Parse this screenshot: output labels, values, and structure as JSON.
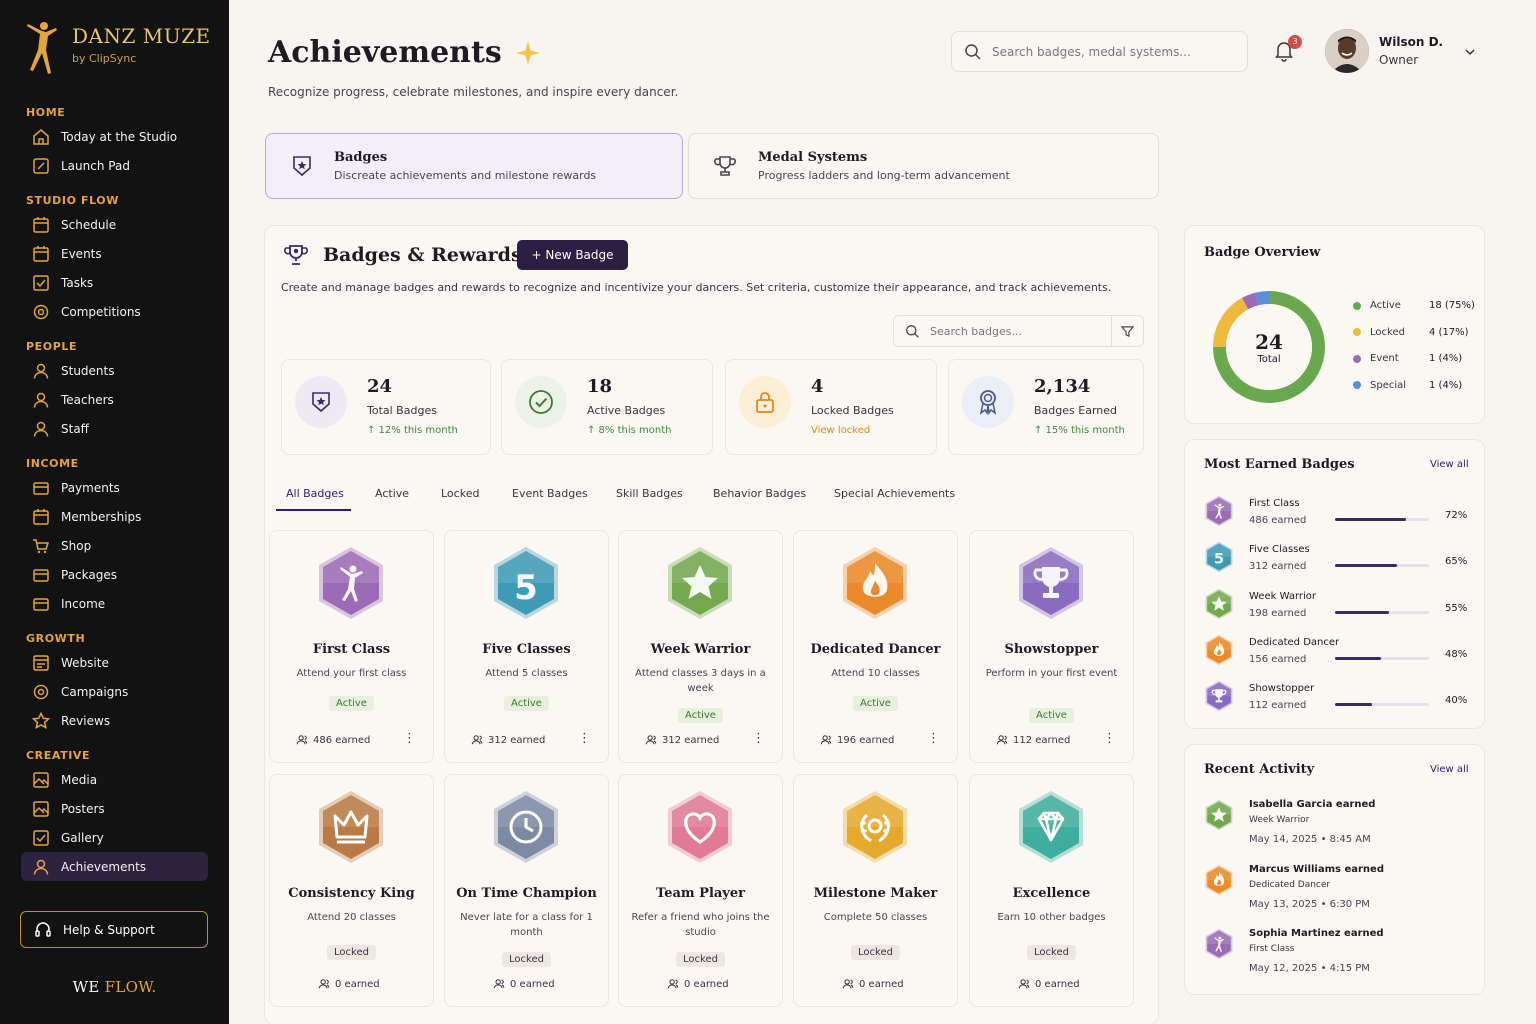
{
  "brand": {
    "name": "DANZ MUZE",
    "sub": "by ClipSync",
    "footer_a": "WE",
    "footer_b": "FLOW."
  },
  "nav": {
    "home": {
      "label": "HOME",
      "items": [
        "Today at the Studio",
        "Launch Pad"
      ]
    },
    "studio": {
      "label": "STUDIO FLOW",
      "items": [
        "Schedule",
        "Events",
        "Tasks",
        "Competitions"
      ]
    },
    "people": {
      "label": "PEOPLE",
      "items": [
        "Students",
        "Teachers",
        "Staff"
      ]
    },
    "income": {
      "label": "INCOME",
      "items": [
        "Payments",
        "Memberships",
        "Shop",
        "Packages",
        "Income"
      ]
    },
    "growth": {
      "label": "GROWTH",
      "items": [
        "Website",
        "Campaigns",
        "Reviews"
      ]
    },
    "creative": {
      "label": "CREATIVE",
      "items": [
        "Media",
        "Posters",
        "Gallery",
        "Achievements"
      ]
    },
    "help": "Help & Support"
  },
  "header": {
    "title": "Achievements",
    "subtitle": "Recognize progress, celebrate milestones, and inspire every dancer.",
    "search_placeholder": "Search badges, medal systems...",
    "notif_count": "3",
    "user_name": "Wilson D.",
    "user_role": "Owner"
  },
  "top_tabs": [
    {
      "title": "Badges",
      "desc": "Discreate achievements and milestone rewards"
    },
    {
      "title": "Medal Systems",
      "desc": "Progress ladders and long-term advancement"
    }
  ],
  "panel": {
    "title": "Badges & Rewards",
    "new_button": "+ New Badge",
    "description": "Create and manage badges and rewards to recognize and incentivize your dancers. Set criteria, customize their appearance, and track achievements.",
    "search_placeholder": "Search badges..."
  },
  "stats": [
    {
      "value": "24",
      "label": "Total Badges",
      "change": "↑ 12% this month"
    },
    {
      "value": "18",
      "label": "Active Badges",
      "change": "↑ 8% this month"
    },
    {
      "value": "4",
      "label": "Locked Badges",
      "change": "View locked"
    },
    {
      "value": "2,134",
      "label": "Badges Earned",
      "change": "↑ 15% this month"
    }
  ],
  "filter_tabs": [
    "All Badges",
    "Active",
    "Locked",
    "Event Badges",
    "Skill Badges",
    "Behavior Badges",
    "Special Achievements"
  ],
  "badges": [
    {
      "name": "First Class",
      "desc": "Attend your first class",
      "status": "Active",
      "earned": "486 earned",
      "icon": "dancer-icon",
      "color": "#9b6bb5"
    },
    {
      "name": "Five Classes",
      "desc": "Attend 5 classes",
      "status": "Active",
      "earned": "312 earned",
      "icon": "number-five-icon",
      "color": "#3f9bb5"
    },
    {
      "name": "Week Warrior",
      "desc": "Attend classes 3 days in a week",
      "status": "Active",
      "earned": "312 earned",
      "icon": "star-icon",
      "color": "#74a84f"
    },
    {
      "name": "Dedicated Dancer",
      "desc": "Attend 10 classes",
      "status": "Active",
      "earned": "196 earned",
      "icon": "flame-icon",
      "color": "#ea8a2a"
    },
    {
      "name": "Showstopper",
      "desc": "Perform in your first event",
      "status": "Active",
      "earned": "112 earned",
      "icon": "trophy-icon",
      "color": "#8a6bbf"
    },
    {
      "name": "Consistency King",
      "desc": "Attend 20 classes",
      "status": "Locked",
      "earned": "0 earned",
      "icon": "crown-icon",
      "color": "#b97a45"
    },
    {
      "name": "On Time Champion",
      "desc": "Never late for a class for 1 month",
      "status": "Locked",
      "earned": "0 earned",
      "icon": "clock-icon",
      "color": "#7d8aa3"
    },
    {
      "name": "Team Player",
      "desc": "Refer a friend who joins the studio",
      "status": "Locked",
      "earned": "0 earned",
      "icon": "heart-icon",
      "color": "#e07a95"
    },
    {
      "name": "Milestone Maker",
      "desc": "Complete 50 classes",
      "status": "Locked",
      "earned": "0 earned",
      "icon": "laurel-icon",
      "color": "#e6a92c"
    },
    {
      "name": "Excellence",
      "desc": "Earn 10 other badges",
      "status": "Locked",
      "earned": "0 earned",
      "icon": "diamond-icon",
      "color": "#3fae9e"
    }
  ],
  "overview": {
    "title": "Badge Overview",
    "total": "24",
    "total_label": "Total",
    "legend": [
      {
        "label": "Active",
        "value": "18 (75%)",
        "color": "#6aa84f",
        "share": 0.75
      },
      {
        "label": "Locked",
        "value": "4 (17%)",
        "color": "#f0b83c",
        "share": 0.17
      },
      {
        "label": "Event",
        "value": "1 (4%)",
        "color": "#9b6bb5",
        "share": 0.04
      },
      {
        "label": "Special",
        "value": "1 (4%)",
        "color": "#5b8fd6",
        "share": 0.04
      }
    ]
  },
  "most_earned": {
    "title": "Most Earned Badges",
    "view_all": "View all",
    "rows": [
      {
        "name": "First Class",
        "earned": "486 earned",
        "pct": "72%",
        "fill": 0.76,
        "color": "#9b6bb5"
      },
      {
        "name": "Five Classes",
        "earned": "312 earned",
        "pct": "65%",
        "fill": 0.66,
        "color": "#3f9bb5"
      },
      {
        "name": "Week Warrior",
        "earned": "198 earned",
        "pct": "55%",
        "fill": 0.57,
        "color": "#74a84f"
      },
      {
        "name": "Dedicated Dancer",
        "earned": "156 earned",
        "pct": "48%",
        "fill": 0.49,
        "color": "#ea8a2a"
      },
      {
        "name": "Showstopper",
        "earned": "112 earned",
        "pct": "40%",
        "fill": 0.39,
        "color": "#8a6bbf"
      }
    ]
  },
  "recent": {
    "title": "Recent Activity",
    "view_all": "View all",
    "rows": [
      {
        "who": "Isabella Garcia earned",
        "badge": "Week Warrior",
        "date": "May 14, 2025 • 8:45 AM",
        "color": "#74a84f"
      },
      {
        "who": "Marcus Williams earned",
        "badge": "Dedicated Dancer",
        "date": "May 13, 2025 • 6:30 PM",
        "color": "#ea8a2a"
      },
      {
        "who": "Sophia Martinez earned",
        "badge": "First Class",
        "date": "May 12, 2025 • 4:15 PM",
        "color": "#9b6bb5"
      }
    ]
  }
}
